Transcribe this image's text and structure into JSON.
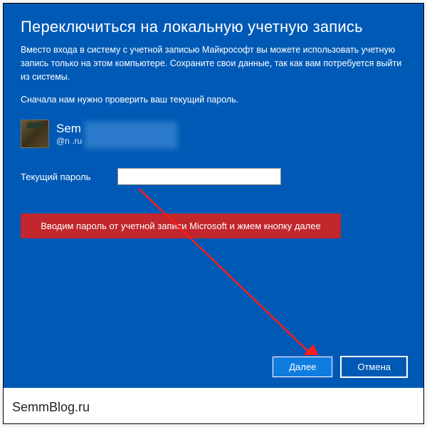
{
  "dialog": {
    "title": "Переключиться на локальную учетную запись",
    "description": "Вместо входа в систему с учетной записью Майкрософт вы можете использовать учетную запись только на этом компьютере. Сохраните свои данные, так как вам потребуется выйти из системы.",
    "subtext": "Сначала нам нужно проверить ваш текущий пароль.",
    "user": {
      "name_visible": "Sem",
      "email_visible_prefix": "",
      "email_visible_suffix": "@n     .ru"
    },
    "password": {
      "label": "Текущий пароль",
      "value": "",
      "placeholder": ""
    },
    "buttons": {
      "next": "Далее",
      "cancel": "Отмена"
    }
  },
  "annotation": {
    "text": "Вводим пароль от учетной записи Microsoft и жмем кнопку далее"
  },
  "watermark": {
    "text": "SemmBlog.ru"
  },
  "colors": {
    "dialog_bg": "#005AB5",
    "annotation_bg": "#c1272d",
    "button_primary_bg": "#0f7de0"
  }
}
